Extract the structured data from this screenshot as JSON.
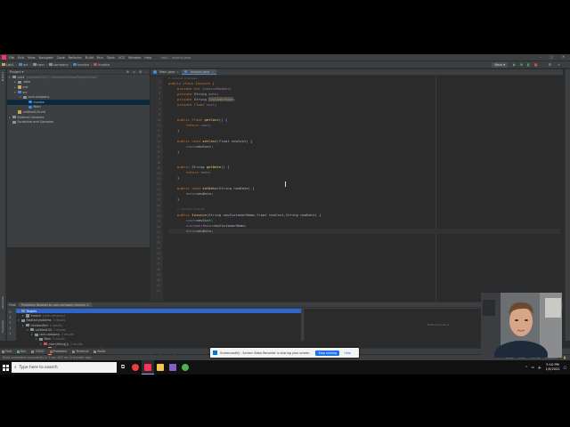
{
  "window": {
    "title": "Lab1 - Invoice.java"
  },
  "menu": [
    "File",
    "Edit",
    "View",
    "Navigate",
    "Code",
    "Refactor",
    "Build",
    "Run",
    "Tools",
    "VCS",
    "Window",
    "Help"
  ],
  "breadcrumbs": [
    "Lab1",
    "src",
    "com",
    "company",
    "Invoice",
    "Invoice"
  ],
  "run_config": "Main",
  "project_panel": {
    "title": "Project",
    "tree": [
      {
        "label": "Lab1",
        "extra": "[untitled104] C:\\Users\\smith\\IdeaProjects\\Lab1",
        "indent": 0,
        "open": true,
        "icon": "folder-icon",
        "color": "#87939a"
      },
      {
        "label": ".idea",
        "extra": "",
        "indent": 1,
        "open": false,
        "icon": "folder-icon",
        "color": "#87939a"
      },
      {
        "label": "out",
        "extra": "",
        "indent": 1,
        "open": false,
        "icon": "folder-icon",
        "color": "#c9a45c"
      },
      {
        "label": "src",
        "extra": "",
        "indent": 1,
        "open": true,
        "icon": "folder-icon",
        "color": "#4a88c7"
      },
      {
        "label": "com.company",
        "extra": "",
        "indent": 2,
        "open": true,
        "icon": "package-icon",
        "color": "#87939a"
      },
      {
        "label": "Invoice",
        "extra": "",
        "indent": 3,
        "open": null,
        "icon": "class-icon",
        "color": "#3d8ee9",
        "selected": true
      },
      {
        "label": "Main",
        "extra": "",
        "indent": 3,
        "open": null,
        "icon": "class-icon",
        "color": "#3d8ee9"
      },
      {
        "label": "untitled104.iml",
        "extra": "",
        "indent": 1,
        "open": null,
        "icon": "module-file-icon",
        "color": "#c9a45c"
      },
      {
        "label": "External Libraries",
        "extra": "",
        "indent": 0,
        "open": false,
        "icon": "library-icon",
        "color": "#87939a"
      },
      {
        "label": "Scratches and Consoles",
        "extra": "",
        "indent": 0,
        "open": null,
        "icon": "scratch-icon",
        "color": "#87939a"
      }
    ]
  },
  "editor": {
    "tabs": [
      {
        "label": "Main.java",
        "active": false
      },
      {
        "label": "Invoice.java",
        "active": true
      }
    ],
    "hint_top": "2 related problems",
    "line_numbers": [
      "3",
      "4",
      "5",
      "6",
      "7",
      "8",
      "9",
      "10",
      "11",
      "12",
      "13",
      "14",
      "15",
      "16",
      "17",
      "18",
      "19",
      "20",
      "21",
      "22",
      "23",
      "24",
      "25",
      "26",
      "27",
      "28",
      "29",
      "30",
      "31",
      "32",
      "33",
      "34",
      "35",
      "36",
      "37",
      "38",
      "39",
      "40",
      "41",
      "42"
    ],
    "lines": {
      "l1": "public class Invoice {",
      "l2_kw": "private int ",
      "l2_f": "invoiceNumber",
      "l3_kw": "private ",
      "l3_t": "String ",
      "l3_f": "date",
      "l4_kw": "private ",
      "l4_t": "String ",
      "l4_f": "customerName",
      "l5_kw": "private float ",
      "l5_f": "cost",
      "l6_kw": "public float ",
      "l6_fn": "getCost",
      "l6_r": "() {",
      "l7_kw": "return ",
      "l7_f": "cost",
      "l8": "}",
      "l9_kw": "public void ",
      "l9_fn": "setCost",
      "l9_r": "(float newCost) {",
      "l10_f": "cost",
      "l10_r": "=newCost;",
      "l11": "}",
      "l12_kw": "public ",
      "l12_t": "String ",
      "l12_fn": "getDate",
      "l12_r": "() {",
      "l13_kw": "return ",
      "l13_f": "date",
      "l14": "}",
      "l15_kw": "public void ",
      "l15_fn": "setDate",
      "l15_r": "(String newDate) {",
      "l16_f": "date",
      "l16_r": "=newDate;",
      "l17": "}",
      "hint_usage": "1 related problem",
      "l18_kw": "public ",
      "l18_fn": "Invoice",
      "l18_r": "(String newCustomerName,float newCost,String newDate) {",
      "l19_f": "cost",
      "l19_r": "=newCost;",
      "l20_f": "customerName",
      "l20_r": "=newCustomerName;",
      "l21_f": "date",
      "l21_r": "=newDate;"
    }
  },
  "find_panel": {
    "label": "Find:",
    "tab": "Problems Related to com.company.Invoice",
    "rows": [
      {
        "text": "Targets",
        "indent": 0,
        "selected": true
      },
      {
        "text": "Invoice",
        "extra": "(com.company)",
        "indent": 1
      },
      {
        "text": "Related problems",
        "extra": "3 results",
        "indent": 0
      },
      {
        "text": "Unclassified",
        "extra": "2 results",
        "indent": 1
      },
      {
        "text": "untitled104",
        "extra": "2 results",
        "indent": 2
      },
      {
        "text": "com.company",
        "extra": "2 results",
        "indent": 3
      },
      {
        "text": "Main",
        "extra": "2 results",
        "indent": 4
      },
      {
        "text": "main(String[])",
        "extra": "2 results",
        "indent": 5
      },
      {
        "text": "5 Invoice myInvoice=new Invoice();",
        "extra": "",
        "indent": 6
      },
      {
        "text": "7 Invoice myOtherInvoice=new Invoice(\"Customer Name\", 123.45, \"January 1, 2022\");",
        "extra": "",
        "indent": 6
      }
    ],
    "preview_placeholder": "Nothing to show"
  },
  "bottom_tools": [
    "Find",
    "Run",
    "TODO",
    "Problems",
    "Terminal",
    "Build"
  ],
  "status": {
    "left": "Build completed successfully in 1 sec, 807 ms (4 minutes ago)",
    "right": [
      "26:22",
      "CRLF",
      "UTF-8",
      "4 spaces"
    ]
  },
  "share_banner": {
    "text": "Screencastify - Screen Video Recorder is sharing your screen.",
    "stop": "Stop sharing",
    "hide": "Hide"
  },
  "taskbar": {
    "search_placeholder": "Type here to search",
    "time": "5:10 PM",
    "date": "1/5/2022"
  },
  "colors": {
    "accent": "#4a88c7",
    "selection": "#2f65ca",
    "keyword": "#cc7832",
    "field": "#9876aa",
    "method": "#ffc66d"
  }
}
